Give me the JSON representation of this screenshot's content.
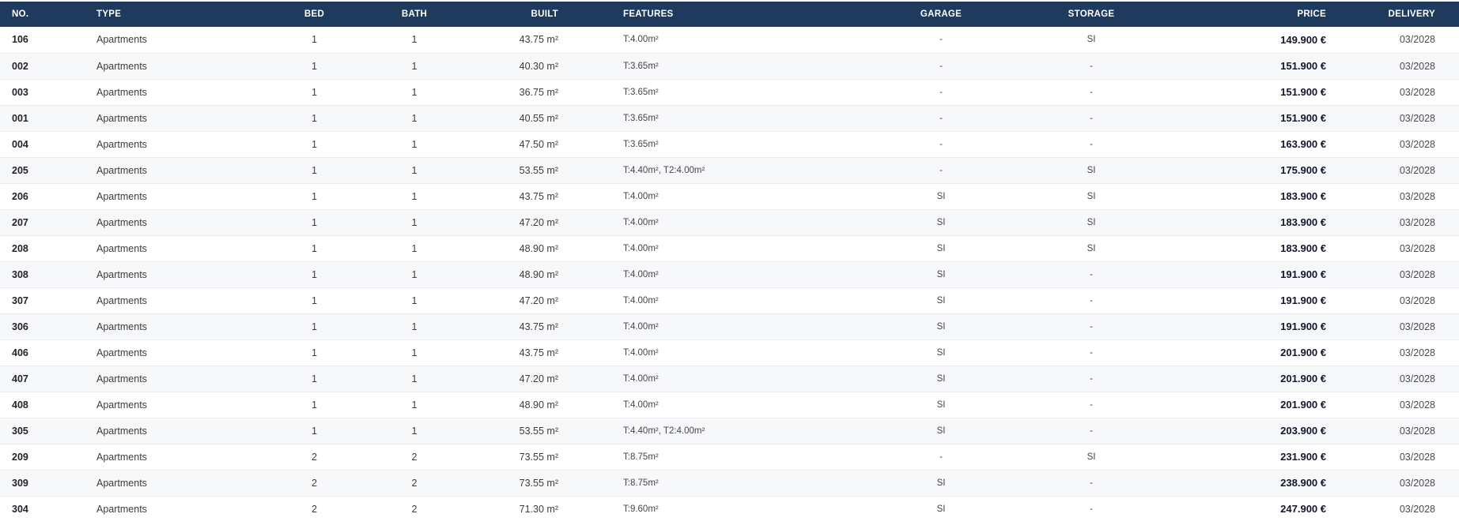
{
  "colors": {
    "header_bg": "#1e3a5c",
    "header_text": "#ffffff",
    "row_alt_bg": "#f7f8fa",
    "price_text": "#15152e"
  },
  "table": {
    "columns": [
      {
        "key": "no",
        "label": "NO."
      },
      {
        "key": "type",
        "label": "TYPE"
      },
      {
        "key": "bed",
        "label": "BED"
      },
      {
        "key": "bath",
        "label": "BATH"
      },
      {
        "key": "built",
        "label": "BUILT"
      },
      {
        "key": "features",
        "label": "FEATURES"
      },
      {
        "key": "garage",
        "label": "GARAGE"
      },
      {
        "key": "storage",
        "label": "STORAGE"
      },
      {
        "key": "price",
        "label": "PRICE"
      },
      {
        "key": "delivery",
        "label": "DELIVERY"
      }
    ],
    "rows": [
      {
        "no": "106",
        "type": "Apartments",
        "bed": "1",
        "bath": "1",
        "built": "43.75 m²",
        "features": "T:4.00m²",
        "garage": "-",
        "storage": "SI",
        "price": "149.900 €",
        "delivery": "03/2028"
      },
      {
        "no": "002",
        "type": "Apartments",
        "bed": "1",
        "bath": "1",
        "built": "40.30 m²",
        "features": "T:3.65m²",
        "garage": "-",
        "storage": "-",
        "price": "151.900 €",
        "delivery": "03/2028"
      },
      {
        "no": "003",
        "type": "Apartments",
        "bed": "1",
        "bath": "1",
        "built": "36.75 m²",
        "features": "T:3.65m²",
        "garage": "-",
        "storage": "-",
        "price": "151.900 €",
        "delivery": "03/2028"
      },
      {
        "no": "001",
        "type": "Apartments",
        "bed": "1",
        "bath": "1",
        "built": "40.55 m²",
        "features": "T:3.65m²",
        "garage": "-",
        "storage": "-",
        "price": "151.900 €",
        "delivery": "03/2028"
      },
      {
        "no": "004",
        "type": "Apartments",
        "bed": "1",
        "bath": "1",
        "built": "47.50 m²",
        "features": "T:3.65m²",
        "garage": "-",
        "storage": "-",
        "price": "163.900 €",
        "delivery": "03/2028"
      },
      {
        "no": "205",
        "type": "Apartments",
        "bed": "1",
        "bath": "1",
        "built": "53.55 m²",
        "features": "T:4.40m², T2:4.00m²",
        "garage": "-",
        "storage": "SI",
        "price": "175.900 €",
        "delivery": "03/2028"
      },
      {
        "no": "206",
        "type": "Apartments",
        "bed": "1",
        "bath": "1",
        "built": "43.75 m²",
        "features": "T:4.00m²",
        "garage": "SI",
        "storage": "SI",
        "price": "183.900 €",
        "delivery": "03/2028"
      },
      {
        "no": "207",
        "type": "Apartments",
        "bed": "1",
        "bath": "1",
        "built": "47.20 m²",
        "features": "T:4.00m²",
        "garage": "SI",
        "storage": "SI",
        "price": "183.900 €",
        "delivery": "03/2028"
      },
      {
        "no": "208",
        "type": "Apartments",
        "bed": "1",
        "bath": "1",
        "built": "48.90 m²",
        "features": "T:4.00m²",
        "garage": "SI",
        "storage": "SI",
        "price": "183.900 €",
        "delivery": "03/2028"
      },
      {
        "no": "308",
        "type": "Apartments",
        "bed": "1",
        "bath": "1",
        "built": "48.90 m²",
        "features": "T:4.00m²",
        "garage": "SI",
        "storage": "-",
        "price": "191.900 €",
        "delivery": "03/2028"
      },
      {
        "no": "307",
        "type": "Apartments",
        "bed": "1",
        "bath": "1",
        "built": "47.20 m²",
        "features": "T:4.00m²",
        "garage": "SI",
        "storage": "-",
        "price": "191.900 €",
        "delivery": "03/2028"
      },
      {
        "no": "306",
        "type": "Apartments",
        "bed": "1",
        "bath": "1",
        "built": "43.75 m²",
        "features": "T:4.00m²",
        "garage": "SI",
        "storage": "-",
        "price": "191.900 €",
        "delivery": "03/2028"
      },
      {
        "no": "406",
        "type": "Apartments",
        "bed": "1",
        "bath": "1",
        "built": "43.75 m²",
        "features": "T:4.00m²",
        "garage": "SI",
        "storage": "-",
        "price": "201.900 €",
        "delivery": "03/2028"
      },
      {
        "no": "407",
        "type": "Apartments",
        "bed": "1",
        "bath": "1",
        "built": "47.20 m²",
        "features": "T:4.00m²",
        "garage": "SI",
        "storage": "-",
        "price": "201.900 €",
        "delivery": "03/2028"
      },
      {
        "no": "408",
        "type": "Apartments",
        "bed": "1",
        "bath": "1",
        "built": "48.90 m²",
        "features": "T:4.00m²",
        "garage": "SI",
        "storage": "-",
        "price": "201.900 €",
        "delivery": "03/2028"
      },
      {
        "no": "305",
        "type": "Apartments",
        "bed": "1",
        "bath": "1",
        "built": "53.55 m²",
        "features": "T:4.40m², T2:4.00m²",
        "garage": "SI",
        "storage": "-",
        "price": "203.900 €",
        "delivery": "03/2028"
      },
      {
        "no": "209",
        "type": "Apartments",
        "bed": "2",
        "bath": "2",
        "built": "73.55 m²",
        "features": "T:8.75m²",
        "garage": "-",
        "storage": "SI",
        "price": "231.900 €",
        "delivery": "03/2028"
      },
      {
        "no": "309",
        "type": "Apartments",
        "bed": "2",
        "bath": "2",
        "built": "73.55 m²",
        "features": "T:8.75m²",
        "garage": "SI",
        "storage": "-",
        "price": "238.900 €",
        "delivery": "03/2028"
      },
      {
        "no": "304",
        "type": "Apartments",
        "bed": "2",
        "bath": "2",
        "built": "71.30 m²",
        "features": "T:9.60m²",
        "garage": "SI",
        "storage": "-",
        "price": "247.900 €",
        "delivery": "03/2028"
      }
    ]
  }
}
